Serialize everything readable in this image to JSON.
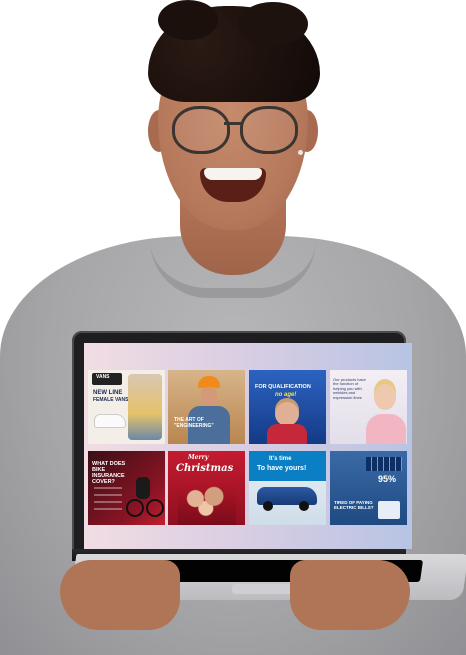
{
  "tiles": [
    {
      "id": "vans",
      "title": "NEW LINE",
      "subtitle": "FEMALE VANS",
      "brand": "VANS",
      "bg": "#f3efe8"
    },
    {
      "id": "engineering",
      "title": "THE ART OF \"ENGINEERING\"",
      "bg": "#c99a63"
    },
    {
      "id": "qualification",
      "title": "FOR QUALIFICATION",
      "accent": "no age!",
      "bg": "#1b4a9a"
    },
    {
      "id": "products",
      "title": "Our products have the function of helping you with wrinkles and expression lines",
      "bg": "#e9e4ef"
    },
    {
      "id": "bike",
      "title": "WHAT DOES BIKE INSURANCE COVER?",
      "bg": "#2a0d12"
    },
    {
      "id": "christmas",
      "title": "Merry",
      "accent": "Christmas",
      "bg": "#b8152a"
    },
    {
      "id": "car",
      "title": "It's time",
      "accent": "To have yours!",
      "bg": "#0a7fc4"
    },
    {
      "id": "bills",
      "percent": "95%",
      "title": "TIRED OF PAYING ELECTRIC BILLS?",
      "bg": "#2c5c98"
    }
  ],
  "colors": {
    "shirt": "#a6a6a9",
    "skin": "#b5785b",
    "laptop": "#1e1e21"
  }
}
